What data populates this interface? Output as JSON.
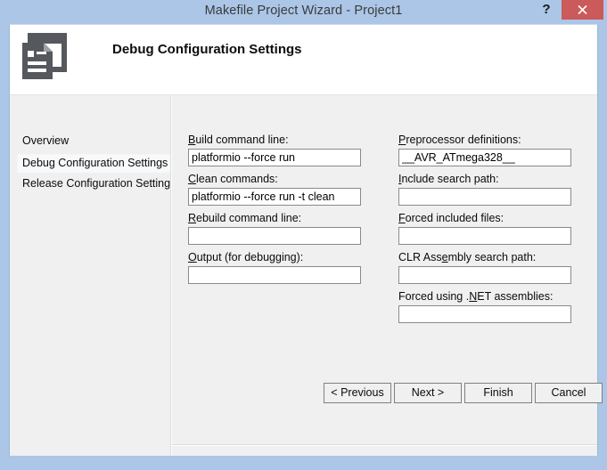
{
  "window": {
    "title": "Makefile Project Wizard - Project1",
    "help_label": "?",
    "close_icon": "close-icon",
    "titlebar_color": "#abc6e6",
    "close_color": "#cb5a5a"
  },
  "header": {
    "title": "Debug Configuration Settings",
    "icon": "document-page-icon"
  },
  "sidebar": {
    "items": [
      {
        "label": "Overview",
        "selected": false
      },
      {
        "label": "Debug Configuration Settings",
        "selected": true
      },
      {
        "label": "Release Configuration Settings",
        "selected": false
      }
    ]
  },
  "form": {
    "left_fields": [
      {
        "label_pre": "",
        "label_key": "B",
        "label_post": "uild command line:",
        "value": "platformio --force run",
        "placeholder": "",
        "name": "build-command-line"
      },
      {
        "label_pre": "",
        "label_key": "C",
        "label_post": "lean commands:",
        "value": "platformio --force run -t clean",
        "placeholder": "",
        "name": "clean-commands"
      },
      {
        "label_pre": "",
        "label_key": "R",
        "label_post": "ebuild command line:",
        "value": "",
        "placeholder": "",
        "name": "rebuild-command-line"
      },
      {
        "label_pre": "",
        "label_key": "O",
        "label_post": "utput (for debugging):",
        "value": "",
        "placeholder": "",
        "name": "output-for-debugging"
      }
    ],
    "right_fields": [
      {
        "label_pre": "",
        "label_key": "P",
        "label_post": "reprocessor definitions:",
        "value": "__AVR_ATmega328__",
        "placeholder": "",
        "name": "preprocessor-definitions"
      },
      {
        "label_pre": "",
        "label_key": "I",
        "label_post": "nclude search path:",
        "value": "",
        "placeholder": "",
        "name": "include-search-path"
      },
      {
        "label_pre": "",
        "label_key": "F",
        "label_post": "orced included files:",
        "value": "",
        "placeholder": "",
        "name": "forced-included-files"
      },
      {
        "label_pre": "CLR Ass",
        "label_key": "e",
        "label_post": "mbly search path:",
        "value": "",
        "placeholder": "",
        "name": "clr-assembly-search-path"
      },
      {
        "label_pre": "Forced using .",
        "label_key": "N",
        "label_post": "ET assemblies:",
        "value": "",
        "placeholder": "",
        "name": "forced-using-net-assemblies"
      }
    ]
  },
  "footer": {
    "buttons": [
      {
        "label": "< Previous",
        "name": "previous-button"
      },
      {
        "label": "Next >",
        "name": "next-button"
      },
      {
        "label": "Finish",
        "name": "finish-button"
      },
      {
        "label": "Cancel",
        "name": "cancel-button"
      }
    ]
  }
}
